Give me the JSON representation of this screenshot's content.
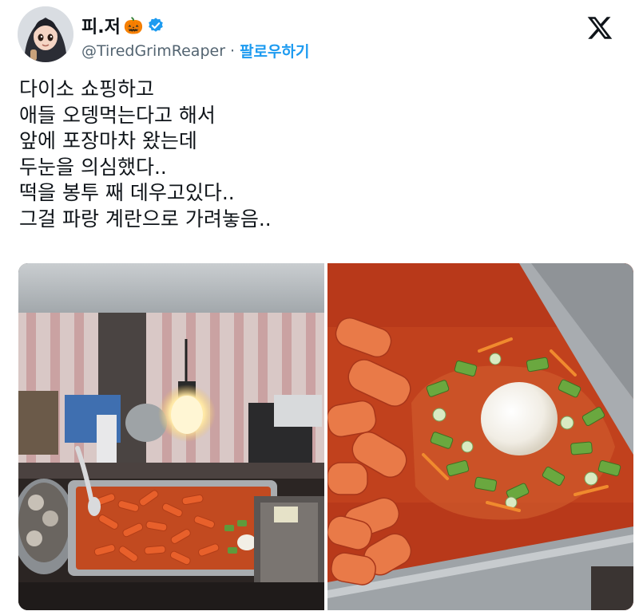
{
  "author": {
    "display_name": "피.저",
    "name_emoji": "🎃",
    "handle": "@TiredGrimReaper",
    "separator": "·",
    "follow_label": "팔로우하기",
    "verified_color": "#1d9bf0",
    "avatar_icon": "avatar-illustration"
  },
  "brand": {
    "logo_icon": "x-logo-icon"
  },
  "tweet": {
    "lines": [
      "다이소 쇼핑하고",
      "애들 오뎅먹는다고 해서",
      "앞에 포장마차 왔는데",
      "두눈을 의심했다..",
      "떡을 봉투 째 데우고있다..",
      "그걸 파랑 계란으로 가려놓음.."
    ]
  },
  "media": {
    "photos": [
      {
        "name": "street-stall-photo",
        "description_icon": "tteokbokki-stall-image"
      },
      {
        "name": "closeup-photo",
        "description_icon": "tteokbokki-closeup-image"
      }
    ]
  }
}
